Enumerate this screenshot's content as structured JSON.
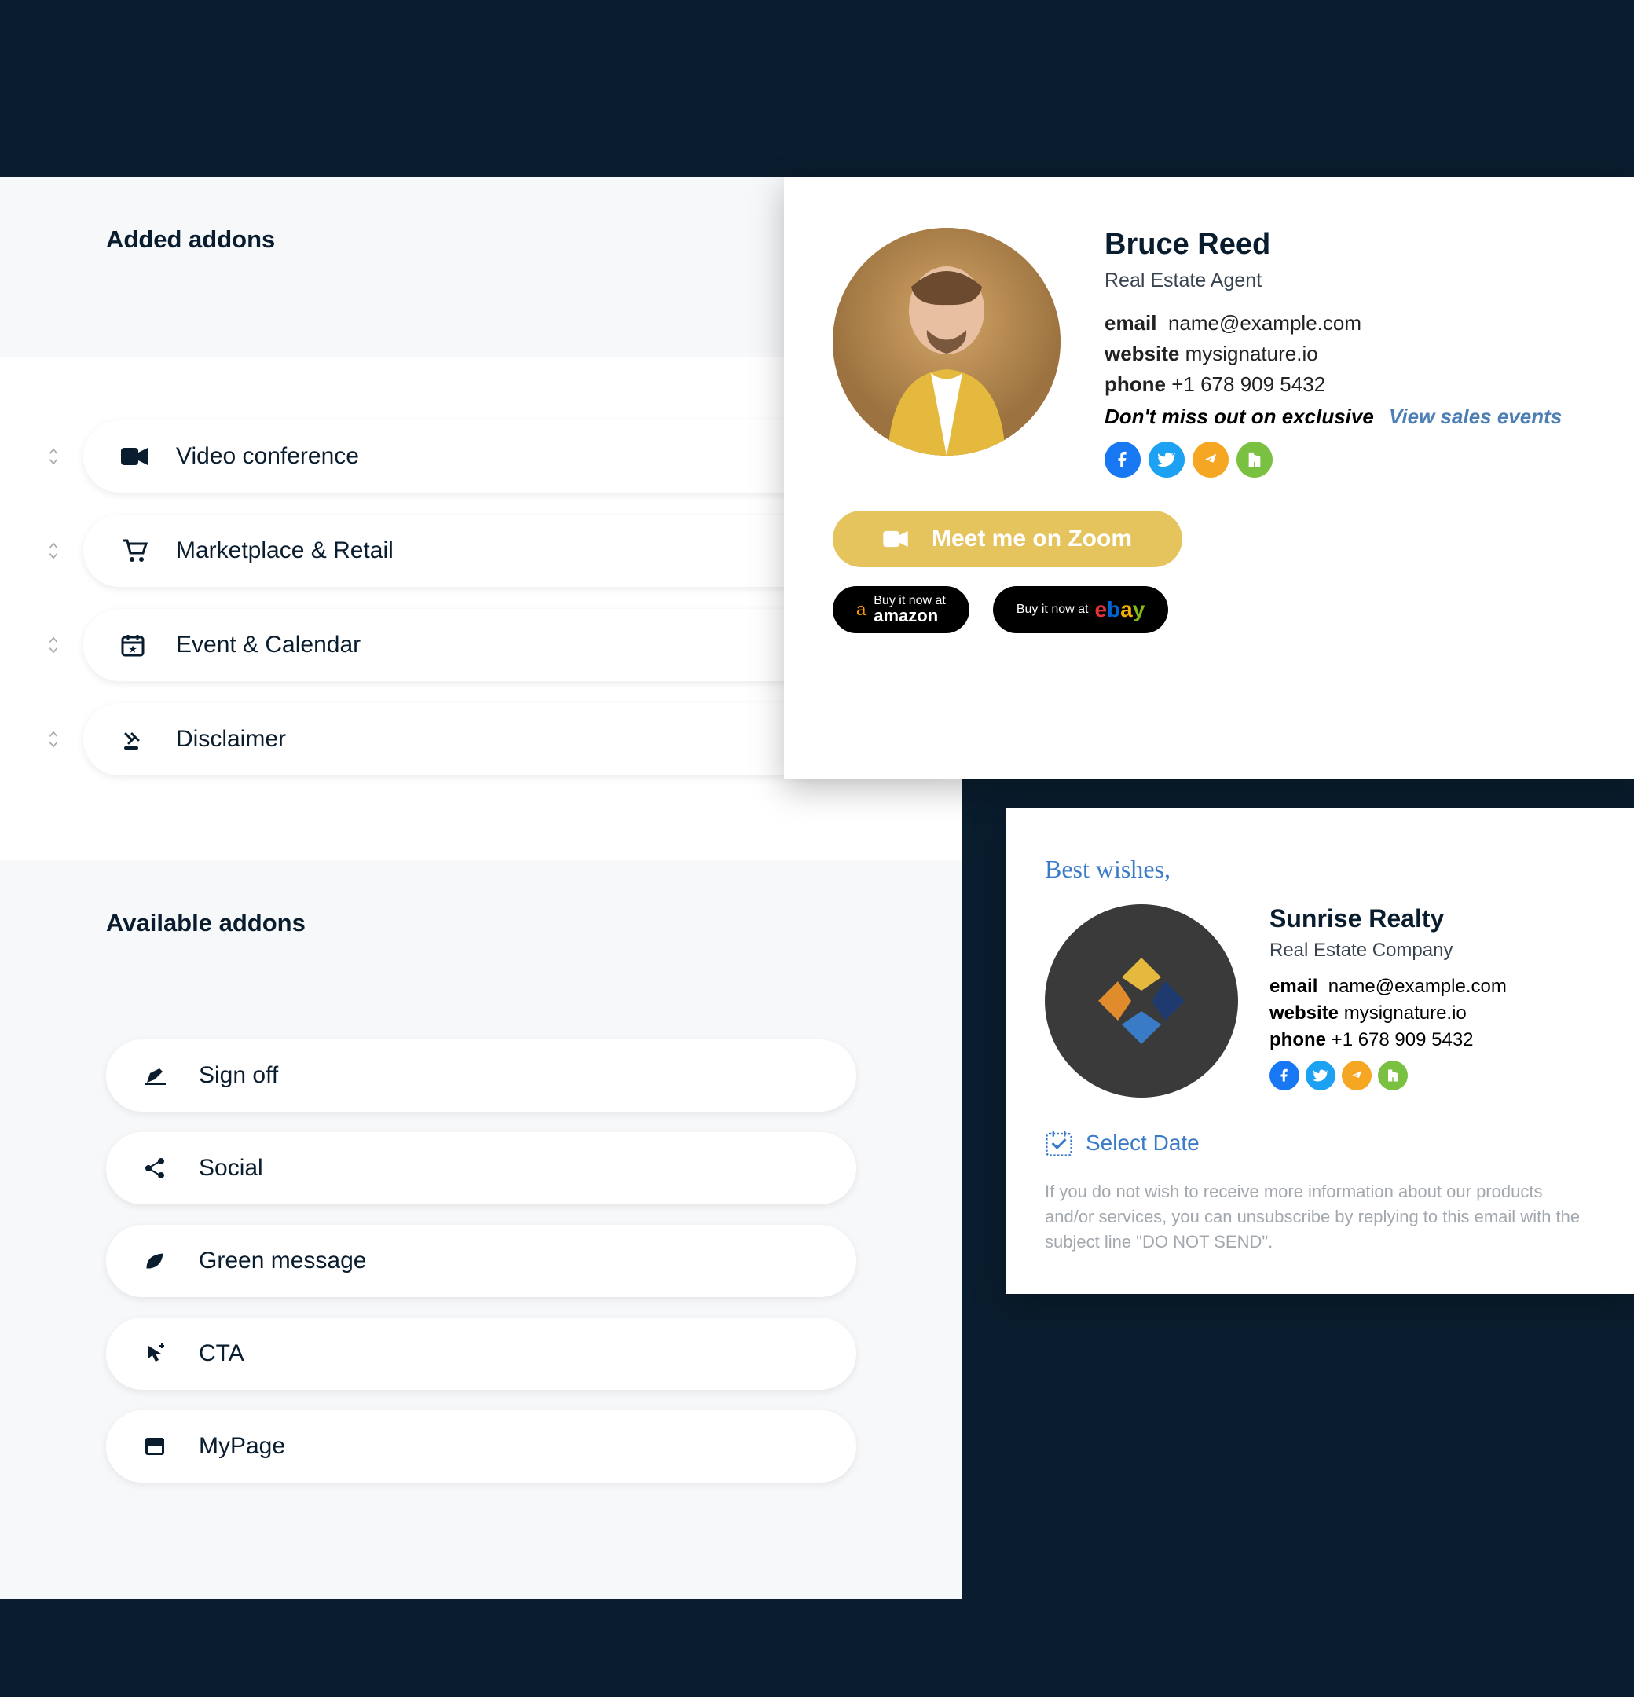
{
  "sections": {
    "added_title": "Added addons",
    "available_title": "Available addons"
  },
  "added_addons": [
    {
      "label": "Video conference",
      "icon": "video"
    },
    {
      "label": "Marketplace & Retail",
      "icon": "cart"
    },
    {
      "label": "Event & Calendar",
      "icon": "calendar"
    },
    {
      "label": "Disclaimer",
      "icon": "gavel"
    }
  ],
  "available_addons": [
    {
      "label": "Sign off",
      "icon": "pen"
    },
    {
      "label": "Social",
      "icon": "share"
    },
    {
      "label": "Green message",
      "icon": "leaf"
    },
    {
      "label": "CTA",
      "icon": "cursor"
    },
    {
      "label": "MyPage",
      "icon": "page"
    }
  ],
  "preview1": {
    "name": "Bruce Reed",
    "role": "Real Estate Agent",
    "email_label": "email",
    "email_value": "name@example.com",
    "website_label": "website",
    "website_value": "mysignature.io",
    "phone_label": "phone",
    "phone_value": "+1 678 909 5432",
    "promo_bold": "Don't miss out on exclusive",
    "promo_link": "View sales events",
    "zoom_btn": "Meet me on Zoom",
    "amazon_small": "Buy it now at",
    "amazon_big": "amazon",
    "ebay_small": "Buy it now at"
  },
  "preview2": {
    "best_wishes": "Best wishes,",
    "company": "Sunrise Realty",
    "role": "Real Estate Company",
    "email_label": "email",
    "email_value": "name@example.com",
    "website_label": "website",
    "website_value": "mysignature.io",
    "phone_label": "phone",
    "phone_value": "+1 678 909 5432",
    "select_date": "Select Date",
    "disclaimer": "If you do not wish to receive more information about our products and/or services, you can unsubscribe by replying to this email with the subject line \"DO NOT SEND\"."
  },
  "colors": {
    "dark": "#0a1d2e",
    "accent": "#e5c45e",
    "blue": "#3a7bc8"
  }
}
